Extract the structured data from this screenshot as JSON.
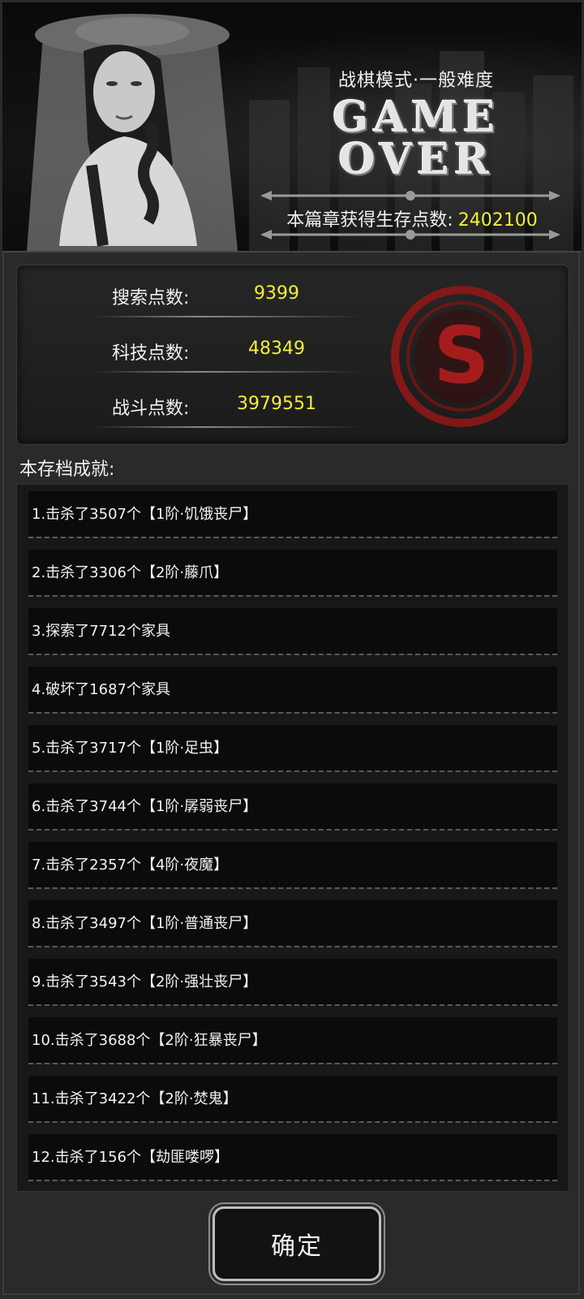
{
  "banner": {
    "mode": "战棋模式·一般难度",
    "title_line1": "GAME",
    "title_line2": "OVER",
    "points_label": "本篇章获得生存点数:",
    "points_value": "2402100"
  },
  "stats": {
    "rows": [
      {
        "label": "搜索点数:",
        "value": "9399"
      },
      {
        "label": "科技点数:",
        "value": "48349"
      },
      {
        "label": "战斗点数:",
        "value": "3979551"
      }
    ],
    "seal_letter": "S",
    "seal_color": "#9c1a1a",
    "value_color": "#f3ef3a"
  },
  "achievements": {
    "title": "本存档成就:",
    "items": [
      "1.击杀了3507个【1阶·饥饿丧尸】",
      "2.击杀了3306个【2阶·藤爪】",
      "3.探索了7712个家具",
      "4.破坏了1687个家具",
      "5.击杀了3717个【1阶·足虫】",
      "6.击杀了3744个【1阶·孱弱丧尸】",
      "7.击杀了2357个【4阶·夜魔】",
      "8.击杀了3497个【1阶·普通丧尸】",
      "9.击杀了3543个【2阶·强壮丧尸】",
      "10.击杀了3688个【2阶·狂暴丧尸】",
      "11.击杀了3422个【2阶·焚鬼】",
      "12.击杀了156个【劫匪喽啰】"
    ]
  },
  "confirm_label": "确定"
}
